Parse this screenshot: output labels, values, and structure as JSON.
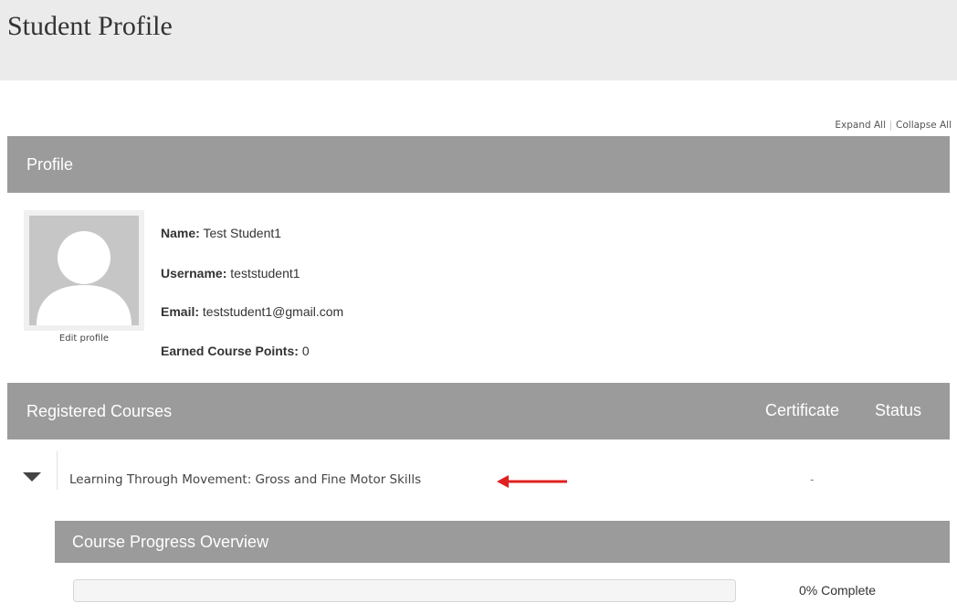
{
  "page": {
    "title": "Student Profile"
  },
  "controls": {
    "expand_all": "Expand All",
    "collapse_all": "Collapse All"
  },
  "profile": {
    "section_title": "Profile",
    "edit_profile": "Edit profile",
    "name_label": "Name:",
    "name_value": "Test Student1",
    "username_label": "Username:",
    "username_value": "teststudent1",
    "email_label": "Email:",
    "email_value": "teststudent1@gmail.com",
    "points_label": "Earned Course Points:",
    "points_value": "0"
  },
  "courses": {
    "section_title": "Registered Courses",
    "col_certificate": "Certificate",
    "col_status": "Status",
    "items": [
      {
        "title": "Learning Through Movement: Gross and Fine Motor Skills",
        "certificate": "-",
        "progress": {
          "section_title": "Course Progress Overview",
          "percent": 0,
          "label": "0% Complete"
        }
      }
    ]
  },
  "colors": {
    "header_bg": "#ebebeb",
    "section_bar": "#9b9b9b",
    "annotation_arrow": "#e02020"
  },
  "icons": {
    "avatar": "default-user-silhouette",
    "toggle": "triangle-down-icon",
    "annotation": "red-arrow-left-icon"
  }
}
